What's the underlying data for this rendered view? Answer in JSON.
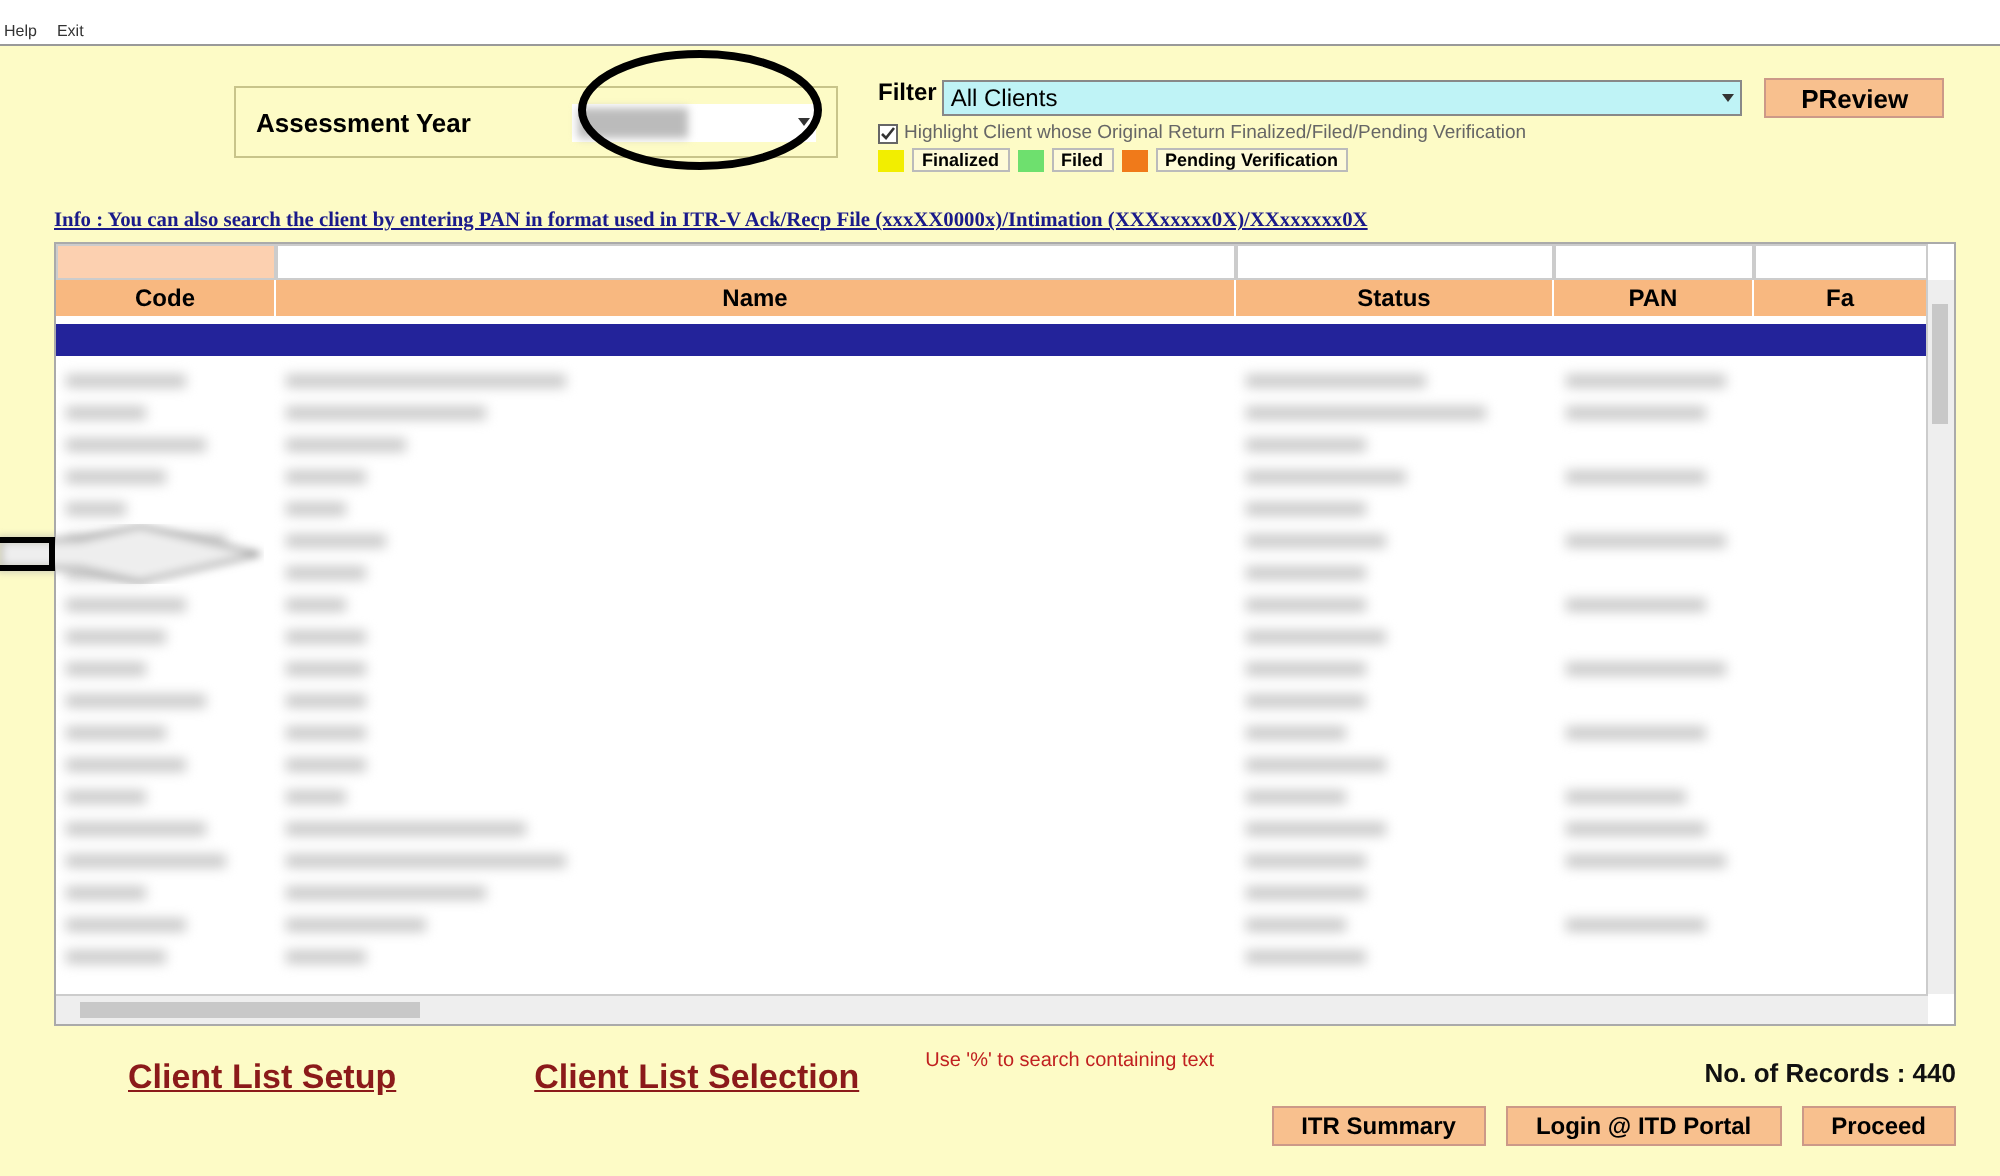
{
  "menu": [
    {
      "label": "Help"
    },
    {
      "label": "Exit"
    }
  ],
  "assessment_year": {
    "label": "Assessment Year"
  },
  "filter": {
    "label": "Filter",
    "value": "All Clients"
  },
  "preview_button": "PReview",
  "highlight": {
    "label": "Highlight Client whose Original Return Finalized/Filed/Pending Verification",
    "checked": true
  },
  "legend": [
    {
      "label": "Finalized",
      "color": "#f2ee00"
    },
    {
      "label": "Filed",
      "color": "#6ee06e"
    },
    {
      "label": "Pending Verification",
      "color": "#f07a1a"
    }
  ],
  "info": "Info : You can also search the client by entering PAN in format used in ITR-V Ack/Recp File (xxxXX0000x)/Intimation (XXXxxxxx0X)/XXxxxxxx0X",
  "table": {
    "columns": [
      "Code",
      "Name",
      "Status",
      "PAN",
      "Fa"
    ]
  },
  "links": [
    "Client List Setup",
    "Client List Selection"
  ],
  "hint": "Use '%'  to search containing text",
  "record_count": "No. of Records : 440",
  "buttons": [
    "ITR Summary",
    "Login @ ITD Portal",
    "Proceed"
  ]
}
